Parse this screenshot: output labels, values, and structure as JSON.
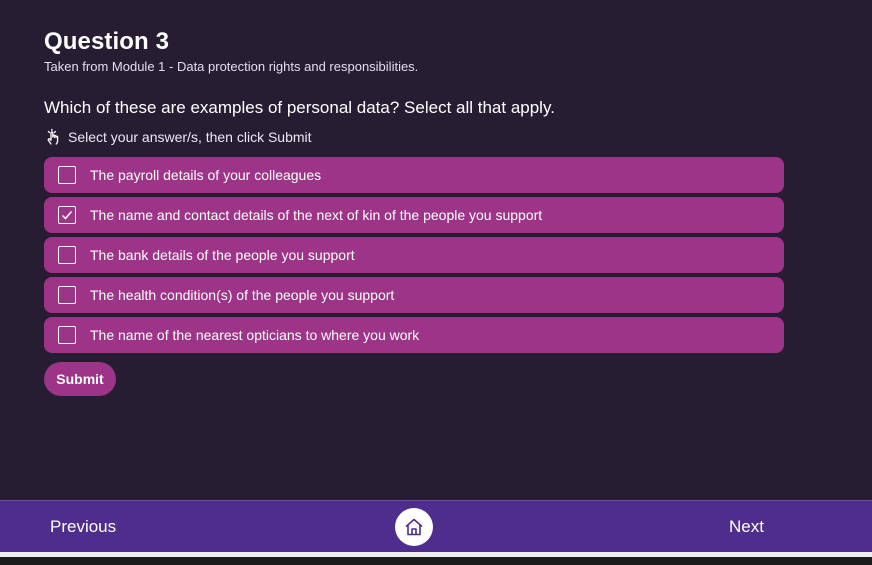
{
  "header": {
    "title": "Question 3",
    "subtitle": "Taken from Module 1 - Data protection rights and responsibilities."
  },
  "question": {
    "text": "Which of these are examples of personal data? Select all that apply.",
    "instruction": "Select your answer/s, then click Submit",
    "instruction_icon": "hand-pointer-icon"
  },
  "options": [
    {
      "label": "The payroll details of your colleagues",
      "checked": false
    },
    {
      "label": "The name and contact details of the next of kin of the people you support",
      "checked": true
    },
    {
      "label": "The bank details of the people you support",
      "checked": false
    },
    {
      "label": "The health condition(s) of the people you support",
      "checked": false
    },
    {
      "label": "The name of the nearest opticians to where you work",
      "checked": false
    }
  ],
  "submit_label": "Submit",
  "nav": {
    "previous_label": "Previous",
    "next_label": "Next",
    "home_icon": "home-icon"
  },
  "colors": {
    "background": "#261d33",
    "option": "#9d3487",
    "navbar": "#4f2d8c"
  }
}
